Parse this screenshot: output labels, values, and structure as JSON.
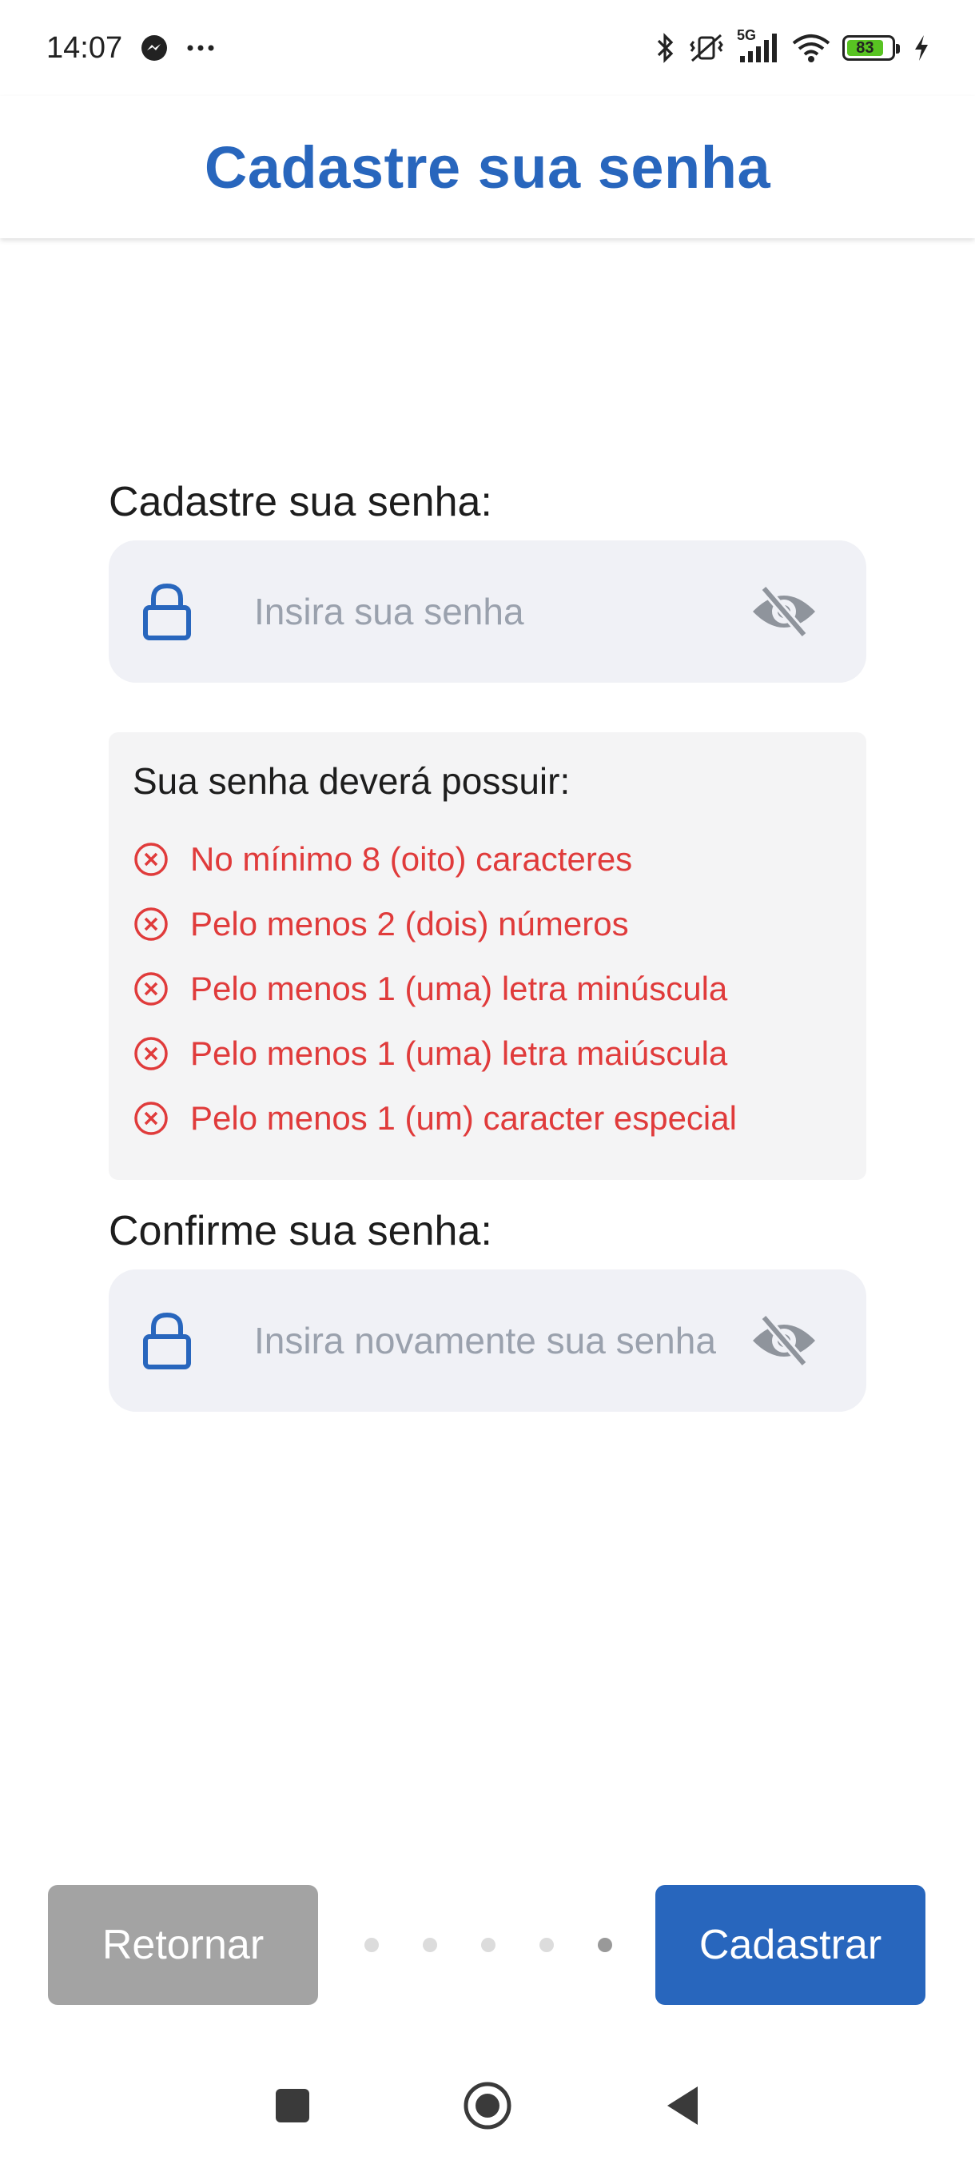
{
  "status_bar": {
    "time": "14:07",
    "network": "5G",
    "battery": "83",
    "battery_level": 0.83,
    "icons": [
      "messenger-icon",
      "more-dots-icon",
      "bluetooth-icon",
      "vibrate-off-icon",
      "signal-icon",
      "wifi-icon",
      "battery-icon",
      "charging-icon"
    ]
  },
  "header": {
    "title": "Cadastre sua senha"
  },
  "password": {
    "label": "Cadastre sua senha:",
    "placeholder": "Insira sua senha",
    "value": ""
  },
  "requirements": {
    "title": "Sua senha deverá possuir:",
    "items": [
      "No mínimo 8 (oito) caracteres",
      "Pelo menos 2 (dois) números",
      "Pelo menos 1 (uma) letra minúscula",
      "Pelo menos 1 (uma) letra maiúscula",
      "Pelo menos 1 (um) caracter especial"
    ],
    "status": "unmet"
  },
  "confirm": {
    "label": "Confirme sua senha:",
    "placeholder": "Insira novamente sua senha",
    "value": ""
  },
  "footer": {
    "back_label": "Retornar",
    "submit_label": "Cadastrar",
    "steps_total": 5,
    "current_step": 5
  },
  "colors": {
    "primary": "#2866bd",
    "error": "#e03b3b",
    "field_bg": "#f0f1f6",
    "back_button": "#a3a3a3"
  }
}
